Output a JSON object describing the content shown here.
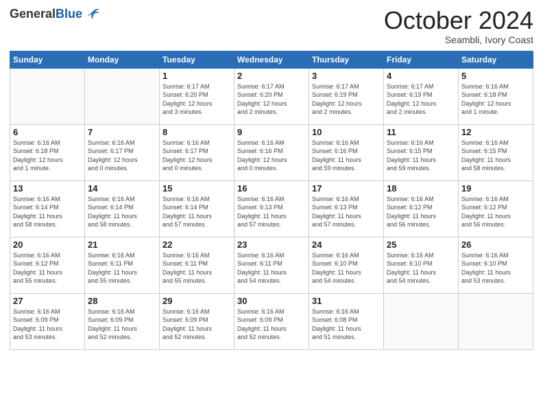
{
  "header": {
    "logo_general": "General",
    "logo_blue": "Blue",
    "month_title": "October 2024",
    "location": "Seambli, Ivory Coast"
  },
  "days_of_week": [
    "Sunday",
    "Monday",
    "Tuesday",
    "Wednesday",
    "Thursday",
    "Friday",
    "Saturday"
  ],
  "weeks": [
    [
      {
        "day": "",
        "info": ""
      },
      {
        "day": "",
        "info": ""
      },
      {
        "day": "1",
        "info": "Sunrise: 6:17 AM\nSunset: 6:20 PM\nDaylight: 12 hours\nand 3 minutes."
      },
      {
        "day": "2",
        "info": "Sunrise: 6:17 AM\nSunset: 6:20 PM\nDaylight: 12 hours\nand 2 minutes."
      },
      {
        "day": "3",
        "info": "Sunrise: 6:17 AM\nSunset: 6:19 PM\nDaylight: 12 hours\nand 2 minutes."
      },
      {
        "day": "4",
        "info": "Sunrise: 6:17 AM\nSunset: 6:19 PM\nDaylight: 12 hours\nand 2 minutes."
      },
      {
        "day": "5",
        "info": "Sunrise: 6:16 AM\nSunset: 6:18 PM\nDaylight: 12 hours\nand 1 minute."
      }
    ],
    [
      {
        "day": "6",
        "info": "Sunrise: 6:16 AM\nSunset: 6:18 PM\nDaylight: 12 hours\nand 1 minute."
      },
      {
        "day": "7",
        "info": "Sunrise: 6:16 AM\nSunset: 6:17 PM\nDaylight: 12 hours\nand 0 minutes."
      },
      {
        "day": "8",
        "info": "Sunrise: 6:16 AM\nSunset: 6:17 PM\nDaylight: 12 hours\nand 0 minutes."
      },
      {
        "day": "9",
        "info": "Sunrise: 6:16 AM\nSunset: 6:16 PM\nDaylight: 12 hours\nand 0 minutes."
      },
      {
        "day": "10",
        "info": "Sunrise: 6:16 AM\nSunset: 6:16 PM\nDaylight: 11 hours\nand 59 minutes."
      },
      {
        "day": "11",
        "info": "Sunrise: 6:16 AM\nSunset: 6:15 PM\nDaylight: 11 hours\nand 59 minutes."
      },
      {
        "day": "12",
        "info": "Sunrise: 6:16 AM\nSunset: 6:15 PM\nDaylight: 11 hours\nand 58 minutes."
      }
    ],
    [
      {
        "day": "13",
        "info": "Sunrise: 6:16 AM\nSunset: 6:14 PM\nDaylight: 11 hours\nand 58 minutes."
      },
      {
        "day": "14",
        "info": "Sunrise: 6:16 AM\nSunset: 6:14 PM\nDaylight: 11 hours\nand 58 minutes."
      },
      {
        "day": "15",
        "info": "Sunrise: 6:16 AM\nSunset: 6:14 PM\nDaylight: 11 hours\nand 57 minutes."
      },
      {
        "day": "16",
        "info": "Sunrise: 6:16 AM\nSunset: 6:13 PM\nDaylight: 11 hours\nand 57 minutes."
      },
      {
        "day": "17",
        "info": "Sunrise: 6:16 AM\nSunset: 6:13 PM\nDaylight: 11 hours\nand 57 minutes."
      },
      {
        "day": "18",
        "info": "Sunrise: 6:16 AM\nSunset: 6:12 PM\nDaylight: 11 hours\nand 56 minutes."
      },
      {
        "day": "19",
        "info": "Sunrise: 6:16 AM\nSunset: 6:12 PM\nDaylight: 11 hours\nand 56 minutes."
      }
    ],
    [
      {
        "day": "20",
        "info": "Sunrise: 6:16 AM\nSunset: 6:12 PM\nDaylight: 11 hours\nand 55 minutes."
      },
      {
        "day": "21",
        "info": "Sunrise: 6:16 AM\nSunset: 6:11 PM\nDaylight: 11 hours\nand 55 minutes."
      },
      {
        "day": "22",
        "info": "Sunrise: 6:16 AM\nSunset: 6:11 PM\nDaylight: 11 hours\nand 55 minutes."
      },
      {
        "day": "23",
        "info": "Sunrise: 6:16 AM\nSunset: 6:11 PM\nDaylight: 11 hours\nand 54 minutes."
      },
      {
        "day": "24",
        "info": "Sunrise: 6:16 AM\nSunset: 6:10 PM\nDaylight: 11 hours\nand 54 minutes."
      },
      {
        "day": "25",
        "info": "Sunrise: 6:16 AM\nSunset: 6:10 PM\nDaylight: 11 hours\nand 54 minutes."
      },
      {
        "day": "26",
        "info": "Sunrise: 6:16 AM\nSunset: 6:10 PM\nDaylight: 11 hours\nand 53 minutes."
      }
    ],
    [
      {
        "day": "27",
        "info": "Sunrise: 6:16 AM\nSunset: 6:09 PM\nDaylight: 11 hours\nand 53 minutes."
      },
      {
        "day": "28",
        "info": "Sunrise: 6:16 AM\nSunset: 6:09 PM\nDaylight: 11 hours\nand 52 minutes."
      },
      {
        "day": "29",
        "info": "Sunrise: 6:16 AM\nSunset: 6:09 PM\nDaylight: 11 hours\nand 52 minutes."
      },
      {
        "day": "30",
        "info": "Sunrise: 6:16 AM\nSunset: 6:09 PM\nDaylight: 11 hours\nand 52 minutes."
      },
      {
        "day": "31",
        "info": "Sunrise: 6:16 AM\nSunset: 6:08 PM\nDaylight: 11 hours\nand 51 minutes."
      },
      {
        "day": "",
        "info": ""
      },
      {
        "day": "",
        "info": ""
      }
    ]
  ]
}
